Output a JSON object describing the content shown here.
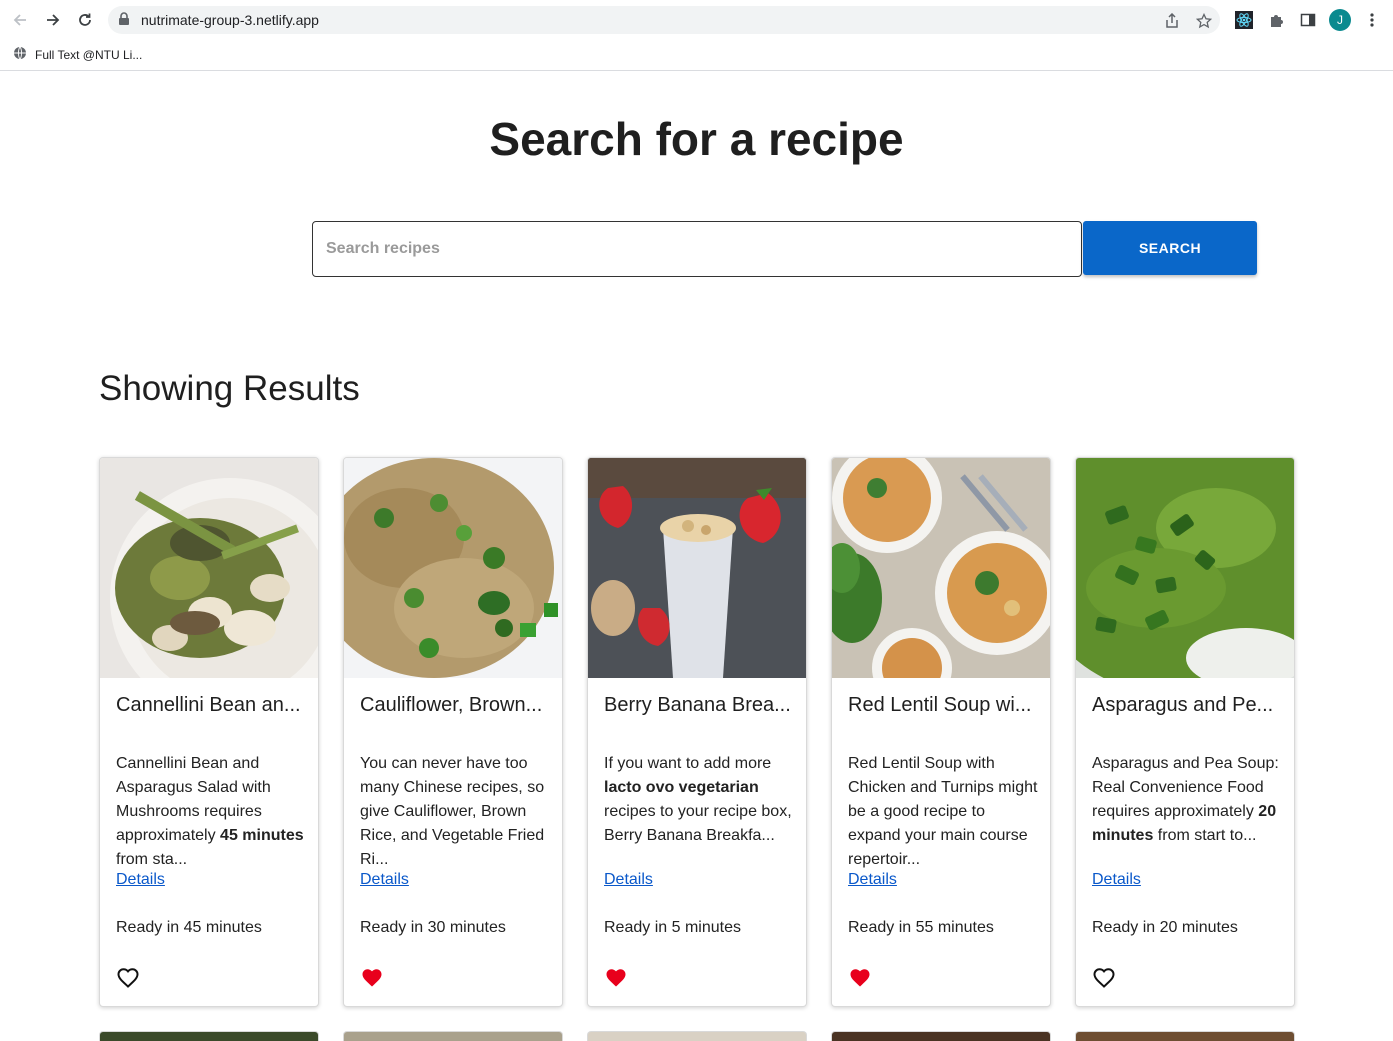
{
  "browser": {
    "url": "nutrimate-group-3.netlify.app",
    "bookmark_label": "Full Text @NTU Li...",
    "profile_initial": "J"
  },
  "page": {
    "title": "Search for a recipe",
    "search_placeholder": "Search recipes",
    "search_button": "SEARCH",
    "results_heading": "Showing Results"
  },
  "recipes": [
    {
      "title": "Cannellini Bean an...",
      "desc_parts": [
        "Cannellini Bean and Asparagus Salad with Mushrooms requires approximately ",
        "45 minutes",
        " from sta..."
      ],
      "link": "Details",
      "ready": "Ready in 45 minutes",
      "favorite": false,
      "image": "cannellini-salad-photo"
    },
    {
      "title": "Cauliflower, Brown...",
      "desc_parts": [
        "You can never have too many Chinese recipes, so give Cauliflower, Brown Rice, and Vegetable Fried Ri...",
        "",
        ""
      ],
      "link": "Details",
      "ready": "Ready in 30 minutes",
      "favorite": true,
      "image": "fried-rice-photo"
    },
    {
      "title": "Berry Banana Brea...",
      "desc_parts": [
        "If you want to add more ",
        "lacto ovo vegetarian",
        " recipes to your recipe box, Berry Banana Breakfa..."
      ],
      "link": "Details",
      "ready": "Ready in 5 minutes",
      "favorite": true,
      "image": "smoothie-photo"
    },
    {
      "title": "Red Lentil Soup wi...",
      "desc_parts": [
        "Red Lentil Soup with Chicken and Turnips might be a good recipe to expand your main course repertoir...",
        "",
        ""
      ],
      "link": "Details",
      "ready": "Ready in 55 minutes",
      "favorite": true,
      "image": "lentil-soup-photo"
    },
    {
      "title": "Asparagus and Pe...",
      "desc_parts": [
        "Asparagus and Pea Soup: Real Convenience Food requires approximately ",
        "20 minutes",
        " from start to..."
      ],
      "link": "Details",
      "ready": "Ready in 20 minutes",
      "favorite": false,
      "image": "green-soup-photo"
    }
  ],
  "colors": {
    "accent": "#0a67c9",
    "heart": "#e8001c",
    "link": "#0a58ca"
  }
}
